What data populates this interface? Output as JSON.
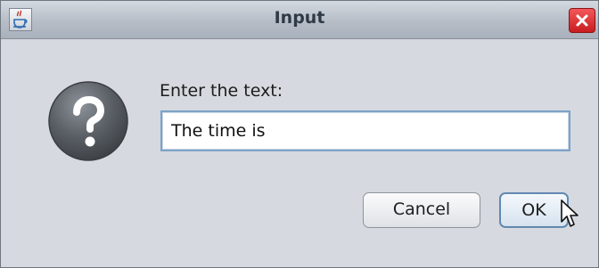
{
  "window": {
    "title": "Input",
    "app_icon": "java-icon",
    "close_icon": "close-icon"
  },
  "dialog": {
    "icon": "question-icon",
    "prompt": "Enter the text:",
    "input_value": "The time is ",
    "buttons": {
      "cancel_label": "Cancel",
      "ok_label": "OK"
    }
  },
  "colors": {
    "close_button": "#dd2b2d",
    "focus_border": "#7da2c6"
  }
}
